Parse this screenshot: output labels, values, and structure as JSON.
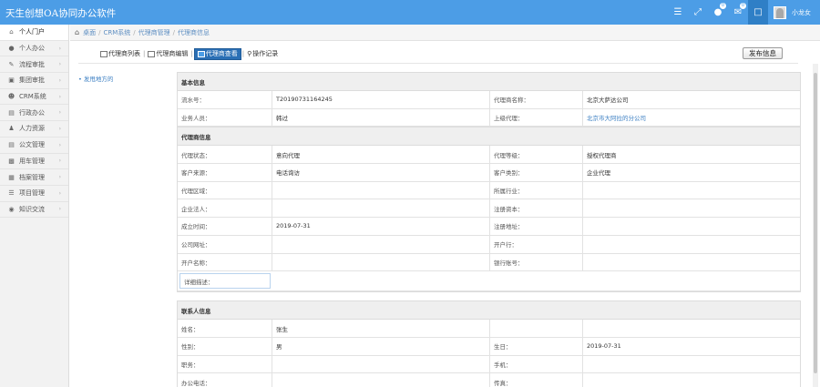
{
  "app": {
    "title": "天生创想OA协同办公软件"
  },
  "topbar": {
    "badges": [
      "0",
      "0"
    ],
    "username": "小龙女"
  },
  "sidebar": {
    "items": [
      {
        "label": "个人门户",
        "icon": "home-icon"
      },
      {
        "label": "个人办公",
        "icon": "person-icon"
      },
      {
        "label": "流程审批",
        "icon": "edit-icon"
      },
      {
        "label": "集团审批",
        "icon": "monitor-icon"
      },
      {
        "label": "CRM系统",
        "icon": "users-icon"
      },
      {
        "label": "行政办公",
        "icon": "book-icon"
      },
      {
        "label": "人力资源",
        "icon": "people-icon"
      },
      {
        "label": "公文管理",
        "icon": "document-icon"
      },
      {
        "label": "用车管理",
        "icon": "car-icon"
      },
      {
        "label": "档案管理",
        "icon": "archive-icon"
      },
      {
        "label": "项目管理",
        "icon": "list-icon"
      },
      {
        "label": "知识交流",
        "icon": "chat-icon"
      }
    ]
  },
  "breadcrumb": {
    "items": [
      "桌面",
      "CRM系统",
      "代理商管理",
      "代理商信息"
    ]
  },
  "toolbar": {
    "tools": [
      "代理商列表",
      "代理商编辑",
      "代理商查看",
      "操作记录"
    ],
    "publish_label": "发布信息"
  },
  "side_link": "• 发甩地方的",
  "form": {
    "basic": {
      "title": "基本信息",
      "serial_label": "流水号：",
      "serial_value": "T20190731164245",
      "agent_name_label": "代理商名称：",
      "agent_name_value": "北京大萨达公司",
      "salesman_label": "业务人员：",
      "salesman_value": "韩过",
      "parent_agent_label": "上级代理：",
      "parent_agent_value": "北京市大阿拉的分公司"
    },
    "agent": {
      "title": "代理商信息",
      "status_label": "代理状态：",
      "status_value": "意向代理",
      "level_label": "代理等级：",
      "level_value": "授权代理商",
      "source_label": "客户来源：",
      "source_value": "电话询访",
      "category_label": "客户类别：",
      "category_value": "企业代理",
      "region_label": "代理区域：",
      "industry_label": "所属行业：",
      "legal_label": "企业法人：",
      "capital_label": "注册资本：",
      "founded_label": "成立时间：",
      "founded_value": "2019-07-31",
      "reg_addr_label": "注册地址：",
      "website_label": "公司网址：",
      "bank_label": "开户行：",
      "account_name_label": "开户名称：",
      "account_no_label": "银行账号：",
      "desc_label": "详细描述："
    },
    "contact": {
      "title": "联系人信息",
      "name_label": "姓名：",
      "name_value": "张生",
      "gender_label": "性别：",
      "gender_value": "男",
      "birthday_label": "生日：",
      "birthday_value": "2019-07-31",
      "position_label": "职务：",
      "mobile_label": "手机：",
      "office_phone_label": "办公电话：",
      "fax_label": "传真："
    }
  }
}
